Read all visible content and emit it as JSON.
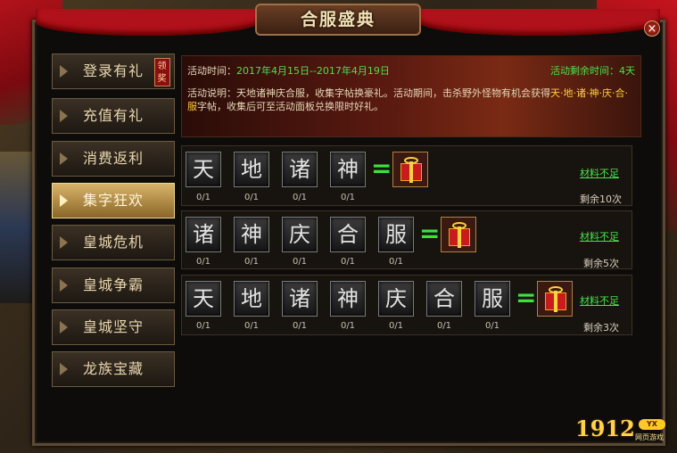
{
  "title": "合服盛典",
  "close_label": "×",
  "sidebar": {
    "items": [
      {
        "label": "登录有礼",
        "badge": "领奖"
      },
      {
        "label": "充值有礼"
      },
      {
        "label": "消费返利"
      },
      {
        "label": "集字狂欢"
      },
      {
        "label": "皇城危机"
      },
      {
        "label": "皇城争霸"
      },
      {
        "label": "皇城坚守"
      },
      {
        "label": "龙族宝藏"
      }
    ],
    "active_index": 3
  },
  "banner": {
    "time_label": "活动时间：",
    "time_value": "2017年4月15日--2017年4月19日",
    "remain_label": "活动剩余时间：",
    "remain_value": "4天",
    "desc_a": "活动说明：天地诸神庆合服，收集字帖换豪礼。活动期间，击杀野外怪物有机会获得",
    "desc_highlight": "天·地·诸·神·庆·合·服",
    "desc_b": "字帖，收集后可至活动面板兑换限时好礼。"
  },
  "rows": [
    {
      "chars": [
        "天",
        "地",
        "诸",
        "神"
      ],
      "counts": [
        "0/1",
        "0/1",
        "0/1",
        "0/1"
      ],
      "status": "材料不足",
      "remaining": "剩余10次"
    },
    {
      "chars": [
        "诸",
        "神",
        "庆",
        "合",
        "服"
      ],
      "counts": [
        "0/1",
        "0/1",
        "0/1",
        "0/1",
        "0/1"
      ],
      "status": "材料不足",
      "remaining": "剩余5次"
    },
    {
      "chars": [
        "天",
        "地",
        "诸",
        "神",
        "庆",
        "合",
        "服"
      ],
      "counts": [
        "0/1",
        "0/1",
        "0/1",
        "0/1",
        "0/1",
        "0/1",
        "0/1"
      ],
      "status": "材料不足",
      "remaining": "剩余3次"
    }
  ],
  "equals_sign": "=",
  "logo": {
    "number": "1912",
    "tag_top": "YX",
    "tag_bottom": "网页游戏"
  },
  "colors": {
    "accent_green": "#4be04b",
    "highlight_yellow": "#ffcf3a",
    "active_tab": "#d8b46a"
  }
}
